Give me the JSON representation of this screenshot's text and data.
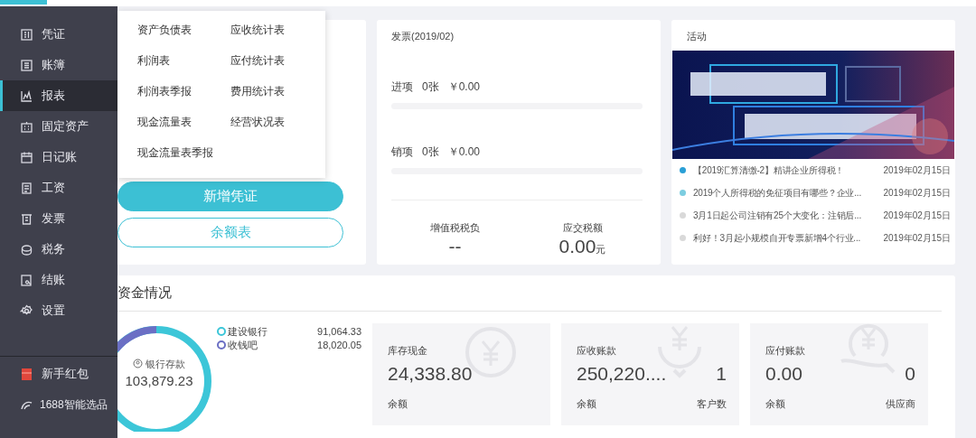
{
  "sidebar": {
    "items": [
      {
        "label": "凭证",
        "selected": false
      },
      {
        "label": "账簿",
        "selected": false
      },
      {
        "label": "报表",
        "selected": true
      },
      {
        "label": "固定资产",
        "selected": false
      },
      {
        "label": "日记账",
        "selected": false
      },
      {
        "label": "工资",
        "selected": false
      },
      {
        "label": "发票",
        "selected": false
      },
      {
        "label": "税务",
        "selected": false
      },
      {
        "label": "结账",
        "selected": false
      },
      {
        "label": "设置",
        "selected": false
      }
    ],
    "extras": [
      {
        "label": "新手红包",
        "kind": "gift"
      },
      {
        "label": "1688智能选品",
        "kind": "link"
      }
    ]
  },
  "reports_menu": {
    "items": [
      "资产负债表",
      "应收统计表",
      "利润表",
      "应付统计表",
      "利润表季报",
      "费用统计表",
      "现金流量表",
      "经营状况表",
      "现金流量表季报"
    ]
  },
  "voucher_card": {
    "buttons": [
      {
        "label": "新增凭证",
        "kind": "primary"
      },
      {
        "label": "余额表",
        "kind": "outline"
      }
    ]
  },
  "invoice_card": {
    "title": "发票(2019/02)",
    "rows": [
      {
        "type": "进项",
        "count": "0张",
        "amount": "￥0.00"
      },
      {
        "type": "销项",
        "count": "0张",
        "amount": "￥0.00"
      }
    ],
    "stats": [
      {
        "label": "增值税税负",
        "value": "--"
      },
      {
        "label": "应交税额",
        "value": "0.00",
        "unit": "元"
      }
    ]
  },
  "activity_card": {
    "title": "活动",
    "news": [
      {
        "title": "【2019汇算清缴-2】精讲企业所得税！",
        "date": "2019年02月15日",
        "color": "#2a9fd6"
      },
      {
        "title": "2019个人所得税的免征项目有哪些？企业...",
        "date": "2019年02月15日",
        "color": "#7ccde0"
      },
      {
        "title": "3月1日起公司注销有25个大变化：注销后...",
        "date": "2019年02月15日",
        "color": "#d9d9d9"
      },
      {
        "title": "利好！3月起小规模自开专票新增4个行业...",
        "date": "2019年02月15日",
        "color": "#d9d9d9"
      }
    ]
  },
  "funds_card": {
    "title": "资金情况",
    "donut": {
      "label": "银行存款",
      "total": "103,879.23"
    },
    "legend": [
      {
        "name": "建设银行",
        "amount": "91,064.33",
        "color": "#3cc6d8"
      },
      {
        "name": "收钱吧",
        "amount": "18,020.05",
        "color": "#6b6fc4"
      }
    ],
    "tiles": [
      {
        "title": "库存现金",
        "amount": "24,338.80",
        "label": "余额"
      },
      {
        "title": "应收账款",
        "amount": "250,220....",
        "label": "余额",
        "count": "1",
        "count_label": "客户数"
      },
      {
        "title": "应付账款",
        "amount": "0.00",
        "label": "余额",
        "count": "0",
        "count_label": "供应商"
      }
    ]
  }
}
